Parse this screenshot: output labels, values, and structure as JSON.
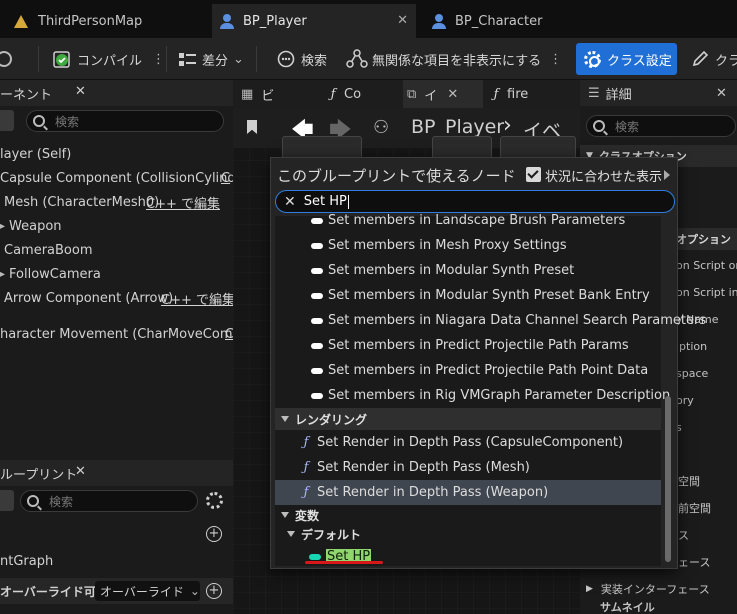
{
  "tabs": [
    {
      "label": "ThirdPersonMap",
      "icon": "map-icon"
    },
    {
      "label": "BP_Player",
      "icon": "blueprint-icon",
      "active": true,
      "close": "✕"
    },
    {
      "label": "BP_Character",
      "icon": "blueprint-icon"
    }
  ],
  "toolbar": {
    "compile": "コンパイル",
    "diff": "差分",
    "search": "検索",
    "hide_unrelated": "無関係な項目を非表示にする",
    "class_settings": "クラス設定",
    "class_defaults_partial": "クラ"
  },
  "components_panel": {
    "title": "ーネント",
    "close": "✕",
    "search_placeholder": "検索",
    "rows": [
      {
        "label": "layer (Self)"
      },
      {
        "label": "Capsule Component (CollisionCylinder)",
        "suffix": "C"
      },
      {
        "label": "Mesh (CharacterMesh0)",
        "suffix": "C++ で編集"
      },
      {
        "label": "Weapon"
      },
      {
        "label": "CameraBoom"
      },
      {
        "label": "FollowCamera"
      },
      {
        "label": "Arrow Component (Arrow)",
        "suffix": "C++ で編集"
      },
      {
        "label": "haracter Movement (CharMoveComp)",
        "suffix": "C"
      }
    ]
  },
  "my_blueprint_panel": {
    "title": "ループリント",
    "close": "✕",
    "search_placeholder": "検索",
    "graph_item": "ntGraph",
    "override_label": "オーバーライド可能",
    "override_dropdown": "オーバーライド"
  },
  "graph_tabs": [
    {
      "label": "ビ"
    },
    {
      "label": "Co"
    },
    {
      "label": "イ",
      "active": true
    },
    {
      "label": "fire"
    }
  ],
  "breadcrumb": {
    "blueprint": "BP_Player",
    "graph": "イベ"
  },
  "details_panel": {
    "title": "詳細",
    "close": "✕",
    "search_placeholder": "検索",
    "section_class_options": "クラスオプション",
    "section_options": "オプション",
    "rows": [
      "on Script on",
      "on Script in S",
      "y Name",
      "iption",
      "space",
      "ory",
      "s",
      "空間",
      "前空間",
      "ス",
      "ェース"
    ],
    "implemented_interfaces": "実装インターフェース",
    "last_row": "サムネイル"
  },
  "popup": {
    "title": "このブループリントで使えるノード",
    "context_sensitive": "状況に合わせた表示",
    "search_value": "Set HP",
    "clear": "✕",
    "items": [
      {
        "label": "Set members in Landscape Brush Parameters",
        "kind": "struct"
      },
      {
        "label": "Set members in Mesh Proxy Settings",
        "kind": "struct"
      },
      {
        "label": "Set members in Modular Synth Preset",
        "kind": "struct"
      },
      {
        "label": "Set members in Modular Synth Preset Bank Entry",
        "kind": "struct"
      },
      {
        "label": "Set members in Niagara Data Channel Search Parameters",
        "kind": "struct"
      },
      {
        "label": "Set members in Predict Projectile Path Params",
        "kind": "struct"
      },
      {
        "label": "Set members in Predict Projectile Path Point Data",
        "kind": "struct"
      },
      {
        "label": "Set members in Rig VMGraph Parameter Description",
        "kind": "struct"
      }
    ],
    "category_rendering": "レンダリング",
    "render_items": [
      {
        "label": "Set Render in Depth Pass (CapsuleComponent)"
      },
      {
        "label": "Set Render in Depth Pass (Mesh)"
      },
      {
        "label": "Set Render in Depth Pass (Weapon)",
        "selected": true
      }
    ],
    "category_variables": "変数",
    "category_default": "デフォルト",
    "variable_item": "Set HP",
    "function_glyph": "ƒ"
  },
  "colors": {
    "accent_blue": "#1f6fd6",
    "variable_pill": "#18d6b3",
    "highlight": "#8fd66c",
    "annotation_red": "#d71818"
  }
}
